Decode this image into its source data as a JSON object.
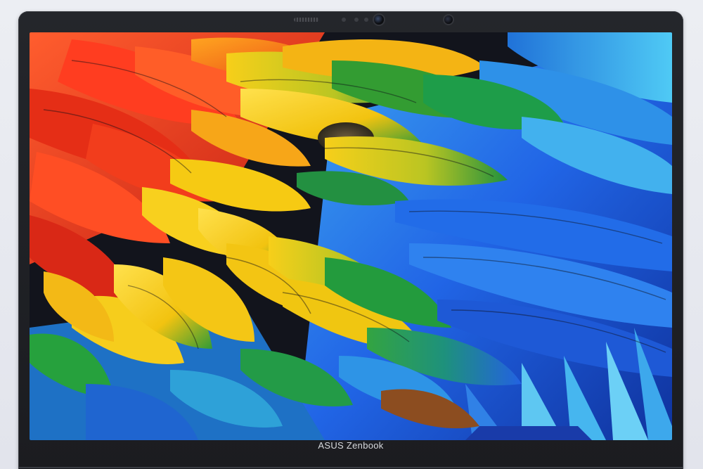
{
  "device": {
    "brand_label": "ASUS Zenbook"
  },
  "wallpaper": {
    "subject": "feather-wallpaper",
    "palette": {
      "red": "#e8311a",
      "orange": "#f07a12",
      "yellow": "#f2c80f",
      "green": "#1f9b3a",
      "blue": "#1b5fe0",
      "cyan": "#2fb6e8",
      "deep_blue": "#0c2f9a"
    }
  },
  "colors": {
    "bezel": "#1d1e22",
    "background": "#e6e8ee",
    "label_text": "#d7d9de"
  }
}
